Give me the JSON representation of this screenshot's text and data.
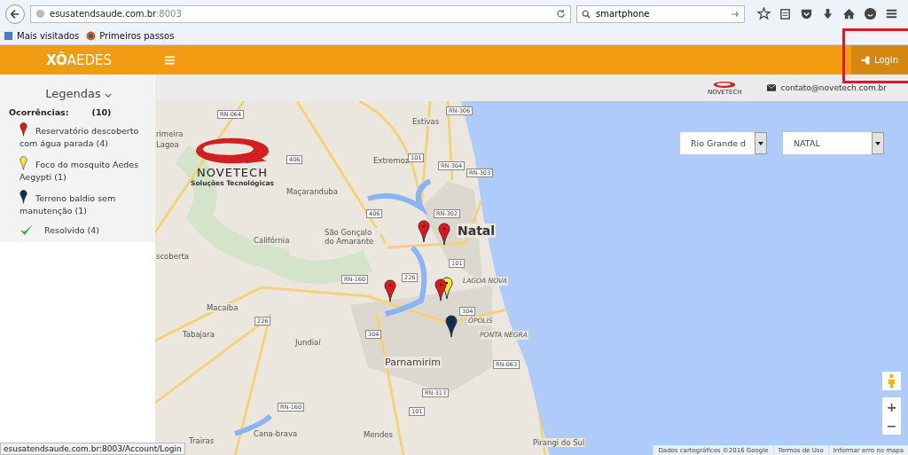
{
  "browser": {
    "url_host": "esusatendsaude.com.br",
    "url_port": ":8003",
    "search": "smartphone"
  },
  "bookmarks": [
    "Mais visitados",
    "Primeiros passos"
  ],
  "header": {
    "logo": "**XÔ**AEDES",
    "login": "Login"
  },
  "contact": {
    "logo_text": "NOVETECH",
    "email": "contato@novetech.com.br"
  },
  "legend": {
    "title": "Legendas",
    "heading": "Ocorrências:",
    "total": "(10)",
    "items": [
      {
        "kind": "pin",
        "color": "#e0161b",
        "label": "Reservatório descoberto com água parada (4)"
      },
      {
        "kind": "pin",
        "color": "#f2ea3a",
        "label": "Foco do mosquito Aedes Aegypti (1)"
      },
      {
        "kind": "pin",
        "color": "#0f2f5a",
        "label": "Terreno baldio sem manutenção (1)"
      },
      {
        "kind": "check",
        "color": "#3cb043",
        "label": "Resolvido (4)"
      }
    ]
  },
  "map": {
    "brand": {
      "name": "NOVETECH",
      "tagline": "Soluções Tecnológicas"
    },
    "state_select": "Rio Grande d",
    "city_select": "NATAL",
    "labels": [
      {
        "text": "RN-064",
        "kind": "road"
      },
      {
        "text": "Estivas",
        "kind": "place"
      },
      {
        "text": "RN-306",
        "kind": "road"
      },
      {
        "text": "rimeira",
        "kind": "place"
      },
      {
        "text": "Lagoa",
        "kind": "place"
      },
      {
        "text": "Extremoz",
        "kind": "place"
      },
      {
        "text": "101",
        "kind": "road"
      },
      {
        "text": "RN-304",
        "kind": "road"
      },
      {
        "text": "RN-303",
        "kind": "road"
      },
      {
        "text": "406",
        "kind": "road"
      },
      {
        "text": "Maçaranduba",
        "kind": "place"
      },
      {
        "text": "406",
        "kind": "road"
      },
      {
        "text": "RN-302",
        "kind": "road"
      },
      {
        "text": "Natal",
        "kind": "city"
      },
      {
        "text": "Califórnia",
        "kind": "place"
      },
      {
        "text": "São Gonçalo do Amarante",
        "kind": "place"
      },
      {
        "text": "scoberta",
        "kind": "place"
      },
      {
        "text": "101",
        "kind": "road"
      },
      {
        "text": "226",
        "kind": "road"
      },
      {
        "text": "RN-160",
        "kind": "road"
      },
      {
        "text": "LAGOA NOVA",
        "kind": "district"
      },
      {
        "text": "304",
        "kind": "road"
      },
      {
        "text": "ÓPOLIS",
        "kind": "district"
      },
      {
        "text": "PONTA NEGRA",
        "kind": "district"
      },
      {
        "text": "Macaíba",
        "kind": "place"
      },
      {
        "text": "226",
        "kind": "road"
      },
      {
        "text": "Tabajara",
        "kind": "place"
      },
      {
        "text": "304",
        "kind": "road"
      },
      {
        "text": "Jundiaí",
        "kind": "place"
      },
      {
        "text": "Parnamirim",
        "kind": "town"
      },
      {
        "text": "RN-063",
        "kind": "road"
      },
      {
        "text": "RN-313",
        "kind": "road"
      },
      {
        "text": "101",
        "kind": "road"
      },
      {
        "text": "RN-160",
        "kind": "road"
      },
      {
        "text": "Cana-brava",
        "kind": "place"
      },
      {
        "text": "Mendes",
        "kind": "place"
      },
      {
        "text": "Trairas",
        "kind": "place"
      },
      {
        "text": "Pirangi do Sul",
        "kind": "place"
      }
    ],
    "markers": [
      {
        "color": "#e0161b"
      },
      {
        "color": "#e0161b"
      },
      {
        "color": "#e0161b"
      },
      {
        "color": "#f2ea3a"
      },
      {
        "color": "#e0161b"
      },
      {
        "color": "#0f2f5a"
      }
    ],
    "zoom_in": "+",
    "zoom_out": "−",
    "attribution": [
      "Dados cartográficos ©2016 Google",
      "Termos de Uso",
      "Informar erro no mapa"
    ]
  },
  "status_bar": "esusatendsaude.com.br:8003/Account/Login"
}
